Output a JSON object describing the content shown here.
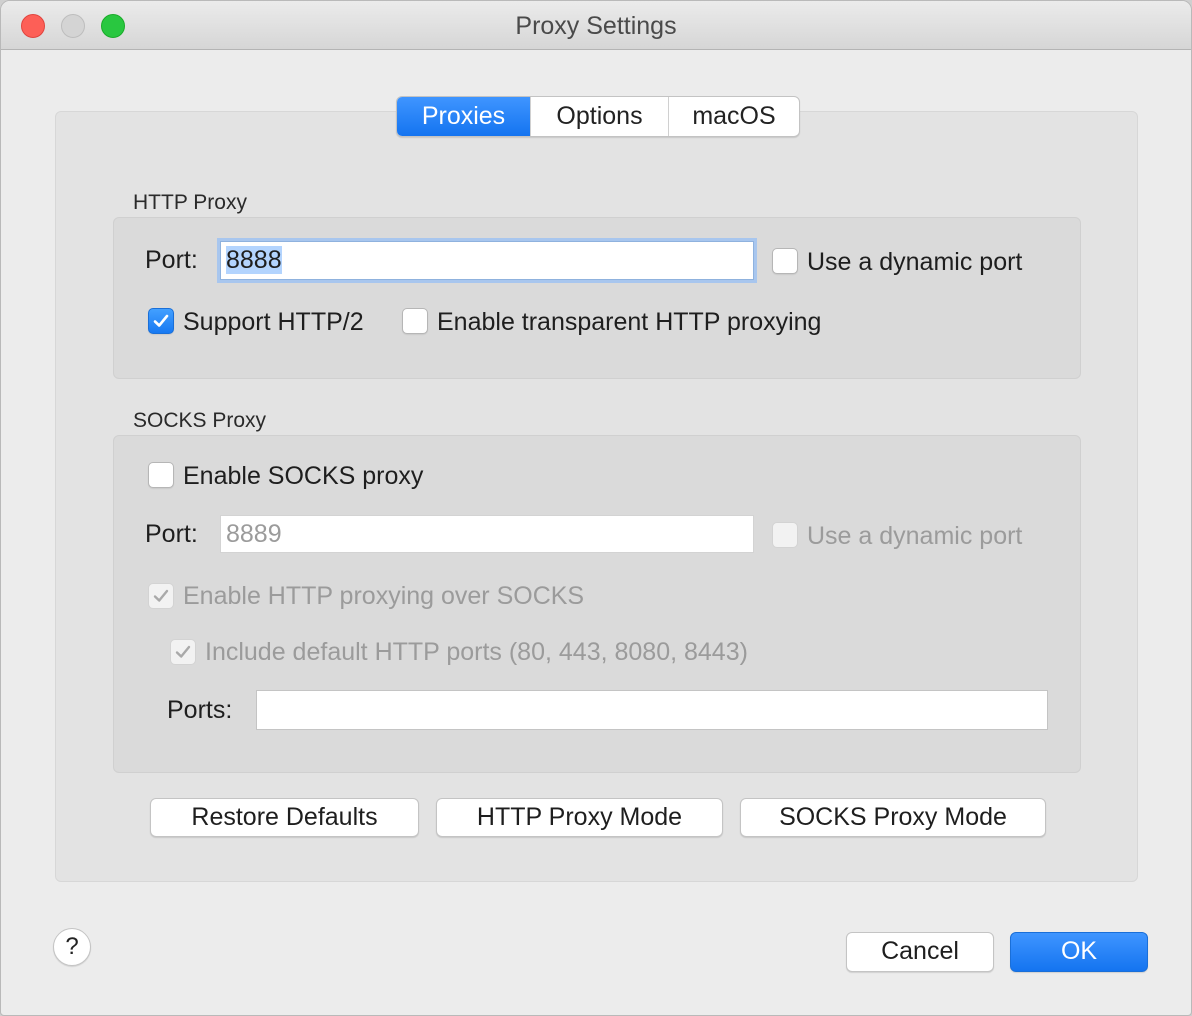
{
  "window": {
    "title": "Proxy Settings"
  },
  "tabs": [
    {
      "label": "Proxies",
      "active": true
    },
    {
      "label": "Options",
      "active": false
    },
    {
      "label": "macOS",
      "active": false
    }
  ],
  "http_proxy": {
    "group_title": "HTTP Proxy",
    "port_label": "Port:",
    "port_value": "8888",
    "dynamic_port_label": "Use a dynamic port",
    "dynamic_port_checked": false,
    "support_http2_label": "Support HTTP/2",
    "support_http2_checked": true,
    "transparent_label": "Enable transparent HTTP proxying",
    "transparent_checked": false
  },
  "socks_proxy": {
    "group_title": "SOCKS Proxy",
    "enable_label": "Enable SOCKS proxy",
    "enable_checked": false,
    "port_label": "Port:",
    "port_placeholder": "8889",
    "dynamic_port_label": "Use a dynamic port",
    "dynamic_port_checked": false,
    "http_over_socks_label": "Enable HTTP proxying over SOCKS",
    "http_over_socks_checked": true,
    "default_ports_label": "Include default HTTP ports (80, 443, 8080, 8443)",
    "default_ports_checked": true,
    "ports_label": "Ports:",
    "ports_value": ""
  },
  "mode_buttons": {
    "restore": "Restore Defaults",
    "http_mode": "HTTP Proxy Mode",
    "socks_mode": "SOCKS Proxy Mode"
  },
  "footer": {
    "help": "?",
    "cancel": "Cancel",
    "ok": "OK"
  },
  "colors": {
    "accent": "#1474f0",
    "window_bg": "#ececec",
    "panel_bg": "#e3e3e3",
    "group_bg": "#dadada",
    "disabled_text": "#9b9b9b"
  }
}
